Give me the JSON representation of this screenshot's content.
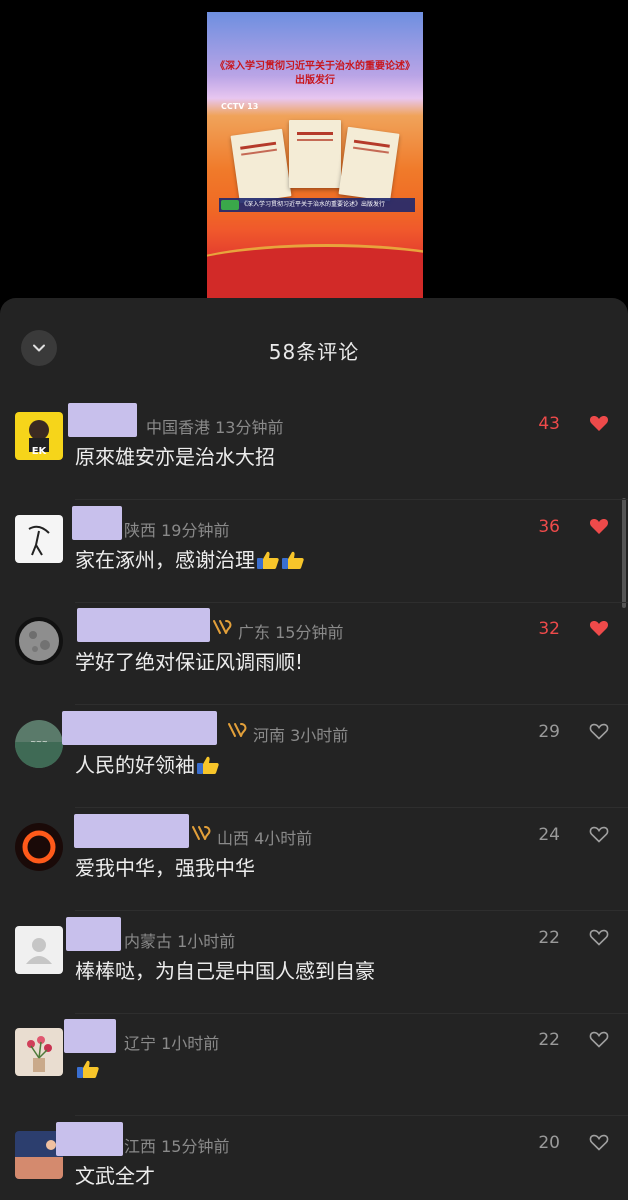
{
  "video": {
    "title_line1": "《深入学习贯彻习近平关于治水的重要论述》",
    "title_line2": "出版发行",
    "channel": "CCTV 13",
    "caption": "《深入学习贯彻习近平关于治水的重要论述》出版发行"
  },
  "sheet": {
    "title": "58条评论",
    "collapse_icon": "chevron-down-icon"
  },
  "colors": {
    "sheet_bg": "#232323",
    "hot_like": "#ee4a4a",
    "like_gray": "#9a9a9a",
    "redaction": "#c8c0ec",
    "vip_badge": "#e3a03a"
  },
  "comments": [
    {
      "meta": "中国香港 13分钟前",
      "text": "原來雄安亦是治水大招",
      "thumbs": 0,
      "likes": "43",
      "liked": true,
      "vip": false
    },
    {
      "meta": "陕西 19分钟前",
      "text": "家在涿州，感谢治理",
      "thumbs": 2,
      "likes": "36",
      "liked": true,
      "vip": false
    },
    {
      "meta": "广东 15分钟前",
      "text": "学好了绝对保证风调雨顺!",
      "thumbs": 0,
      "likes": "32",
      "liked": true,
      "vip": true
    },
    {
      "meta": "河南 3小时前",
      "text": "人民的好领袖",
      "thumbs": 1,
      "likes": "29",
      "liked": false,
      "vip": true
    },
    {
      "meta": "山西 4小时前",
      "text": "爱我中华，强我中华",
      "thumbs": 0,
      "likes": "24",
      "liked": false,
      "vip": true
    },
    {
      "meta": "内蒙古 1小时前",
      "text": "棒棒哒，为自己是中国人感到自豪",
      "thumbs": 0,
      "likes": "22",
      "liked": false,
      "vip": false
    },
    {
      "meta": "辽宁 1小时前",
      "text": "",
      "thumbs": 1,
      "likes": "22",
      "liked": false,
      "vip": false
    },
    {
      "meta": "江西 15分钟前",
      "text": "文武全才",
      "thumbs": 0,
      "likes": "20",
      "liked": false,
      "vip": false
    }
  ]
}
